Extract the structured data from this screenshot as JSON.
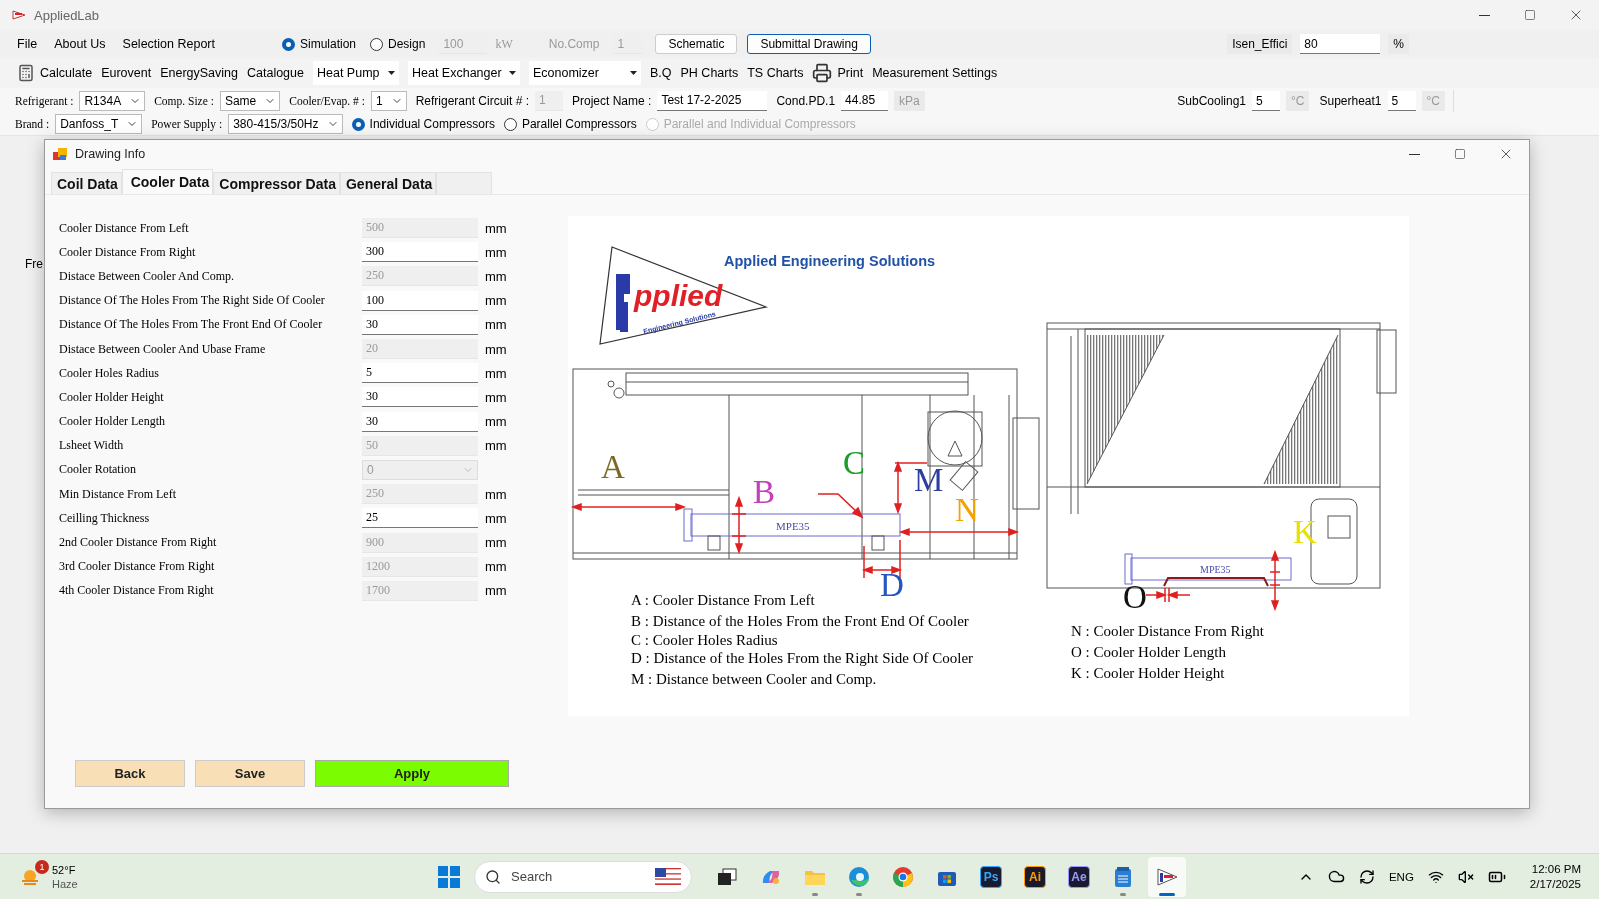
{
  "app": {
    "title": "AppliedLab"
  },
  "menu": [
    "File",
    "About Us",
    "Selection Report"
  ],
  "mode": [
    {
      "label": "Simulation",
      "selected": true
    },
    {
      "label": "Design",
      "selected": false
    }
  ],
  "capacity": {
    "value": "100",
    "unit": "kW",
    "disabled": true
  },
  "no_comp": {
    "label": "No.Comp",
    "value": "1",
    "disabled": true
  },
  "header_buttons": [
    {
      "label": "Schematic",
      "selected": false
    },
    {
      "label": "Submittal Drawing",
      "selected": true
    }
  ],
  "isen": {
    "label": "Isen_Effici",
    "value": "80",
    "unit": "%"
  },
  "toolbar": [
    {
      "kind": "calculator",
      "label": "Calculate"
    },
    {
      "kind": "plain",
      "label": "Eurovent"
    },
    {
      "kind": "plain",
      "label": "EnergySaving"
    },
    {
      "kind": "plain",
      "label": "Catalogue"
    },
    {
      "kind": "dropdown",
      "label": "Heat Pump"
    },
    {
      "kind": "dropdown",
      "label": "Heat Exchanger"
    },
    {
      "kind": "dropdown",
      "label": "Economizer"
    },
    {
      "kind": "plain",
      "label": "B.Q"
    },
    {
      "kind": "plain",
      "label": "PH Charts"
    },
    {
      "kind": "plain",
      "label": "TS Charts"
    },
    {
      "kind": "printer",
      "label": "Print"
    },
    {
      "kind": "plain",
      "label": "Measurement Settings"
    }
  ],
  "params": {
    "row_1": [
      {
        "kind": "combo",
        "label": "Refrigerant :",
        "value": "R134A"
      },
      {
        "kind": "combo",
        "label": "Comp. Size :",
        "value": "Same"
      },
      {
        "kind": "combo",
        "label": "Cooler/Evap. # :",
        "value": "1"
      },
      {
        "kind": "field",
        "label": "Refrigerant Circuit # :",
        "value": "1",
        "disabled": true
      },
      {
        "kind": "field",
        "label": "Project Name :",
        "value": "Test 17-2-2025",
        "disabled": false
      },
      {
        "kind": "field",
        "label": "Cond.PD.1",
        "value": "44.85",
        "unit": "kPa",
        "disabled": false
      }
    ],
    "temperatures": [
      {
        "kind": "field",
        "label": "SubCooling1",
        "value": "5",
        "unit": "°C",
        "disabled": false
      },
      {
        "kind": "field",
        "label": "Superheat1",
        "value": "5",
        "unit": "°C",
        "disabled": false
      }
    ],
    "row_2": [
      {
        "kind": "combo",
        "label": "Brand :",
        "value": "Danfoss_T"
      },
      {
        "kind": "combo",
        "label": "Power Supply :",
        "value": "380-415/3/50Hz"
      },
      {
        "kind": "radio",
        "label": "Individual Compressors",
        "selected": true,
        "disabled": false
      },
      {
        "kind": "radio",
        "label": "Parallel Compressors",
        "selected": false,
        "disabled": false
      },
      {
        "kind": "radio",
        "label": "Parallel and Individual Compressors",
        "selected": false,
        "disabled": true
      }
    ]
  },
  "background_text": "Fre",
  "dialog": {
    "title": "Drawing Info",
    "tabs": [
      {
        "label": "Coil Data",
        "selected": false
      },
      {
        "label": "Cooler Data",
        "selected": true
      },
      {
        "label": "Compressor Data",
        "selected": false
      },
      {
        "label": "General Data",
        "selected": false
      }
    ],
    "rows": [
      {
        "kind": "field",
        "label": "Cooler Distance From Left",
        "value": "500",
        "unit": "mm",
        "disabled": true
      },
      {
        "kind": "field",
        "label": "Cooler Distance From Right",
        "value": "300",
        "unit": "mm",
        "disabled": false
      },
      {
        "kind": "field",
        "label": "Distace Between Cooler And Comp.",
        "value": "250",
        "unit": "mm",
        "disabled": true
      },
      {
        "kind": "field",
        "label": "Distance Of The Holes From The Right Side Of Cooler",
        "value": "100",
        "unit": "mm",
        "disabled": false
      },
      {
        "kind": "field",
        "label": "Distance Of The Holes From The Front End Of Cooler",
        "value": "30",
        "unit": "mm",
        "disabled": false
      },
      {
        "kind": "field",
        "label": "Distace Between Cooler And Ubase Frame",
        "value": "20",
        "unit": "mm",
        "disabled": true
      },
      {
        "kind": "field",
        "label": "Cooler Holes Radius",
        "value": "5",
        "unit": "mm",
        "disabled": false
      },
      {
        "kind": "field",
        "label": "Cooler Holder Height",
        "value": "30",
        "unit": "mm",
        "disabled": false
      },
      {
        "kind": "field",
        "label": "Cooler Holder Length",
        "value": "30",
        "unit": "mm",
        "disabled": false
      },
      {
        "kind": "field",
        "label": "Lsheet Width",
        "value": "50",
        "unit": "mm",
        "disabled": true
      },
      {
        "kind": "combo",
        "label": "Cooler Rotation",
        "value": "0",
        "disabled": true
      },
      {
        "kind": "field",
        "label": "Min Distance From Left",
        "value": "250",
        "unit": "mm",
        "disabled": true
      },
      {
        "kind": "field",
        "label": "Ceilling Thickness",
        "value": "25",
        "unit": "mm",
        "disabled": false
      },
      {
        "kind": "field",
        "label": "2nd Cooler Distance From Right",
        "value": "900",
        "unit": "mm",
        "disabled": true
      },
      {
        "kind": "field",
        "label": "3rd Cooler Distance From Right",
        "value": "1200",
        "unit": "mm",
        "disabled": true
      },
      {
        "kind": "field",
        "label": "4th Cooler Distance From Right",
        "value": "1700",
        "unit": "mm",
        "disabled": true
      }
    ],
    "diagram": {
      "company": "Applied Engineering Solutions",
      "logo_word": "pplied",
      "logo_tagline": "Engineering Solutions",
      "tube_labels": [
        "MPE35",
        "MPE35"
      ],
      "letters": [
        {
          "label": "A",
          "color": "#7d6a22"
        },
        {
          "label": "B",
          "color": "#c341b8"
        },
        {
          "label": "C",
          "color": "#1e9c2a"
        },
        {
          "label": "M",
          "color": "#2c3f9e"
        },
        {
          "label": "N",
          "color": "#f0a400"
        },
        {
          "label": "D",
          "color": "#2356c0"
        },
        {
          "label": "O",
          "color": "#111111"
        },
        {
          "label": "K",
          "color": "#e8e000"
        }
      ],
      "legend_left": [
        "A : Cooler Distance From Left",
        "B : Distance of the Holes From the Front End Of Cooler",
        "C : Cooler Holes Radius",
        "D : Distance of the Holes From the Right Side Of Cooler",
        "M : Distance between Cooler and Comp."
      ],
      "legend_right": [
        "N : Cooler Distance From Right",
        "O : Cooler Holder Length",
        "K : Cooler Holder Height"
      ]
    },
    "buttons": [
      {
        "kind": "secondary",
        "label": "Back"
      },
      {
        "kind": "secondary",
        "label": "Save"
      },
      {
        "kind": "primary",
        "label": "Apply"
      }
    ]
  },
  "taskbar": {
    "weather": {
      "temp": "52°F",
      "condition": "Haze",
      "badge": "1"
    },
    "search": {
      "placeholder": "Search"
    },
    "apps": [
      {
        "kind": "task-view",
        "running": false,
        "selected": false
      },
      {
        "kind": "copilot",
        "running": false,
        "selected": false
      },
      {
        "kind": "folder",
        "running": true,
        "selected": false
      },
      {
        "kind": "edge",
        "running": true,
        "selected": false
      },
      {
        "kind": "chrome",
        "running": false,
        "selected": false
      },
      {
        "kind": "store",
        "running": false,
        "selected": false
      },
      {
        "kind": "letter",
        "label": "Ps",
        "color": "#31a8ff",
        "running": false,
        "selected": false
      },
      {
        "kind": "letter",
        "label": "Ai",
        "color": "#ff9a00",
        "running": false,
        "selected": false
      },
      {
        "kind": "letter",
        "label": "Ae",
        "color": "#9999ff",
        "running": false,
        "selected": false
      },
      {
        "kind": "notepad",
        "running": true,
        "selected": false
      },
      {
        "kind": "applied",
        "running": true,
        "selected": true
      }
    ],
    "tray": {
      "language": "ENG",
      "time": "12:06 PM",
      "date": "2/17/2025"
    }
  }
}
